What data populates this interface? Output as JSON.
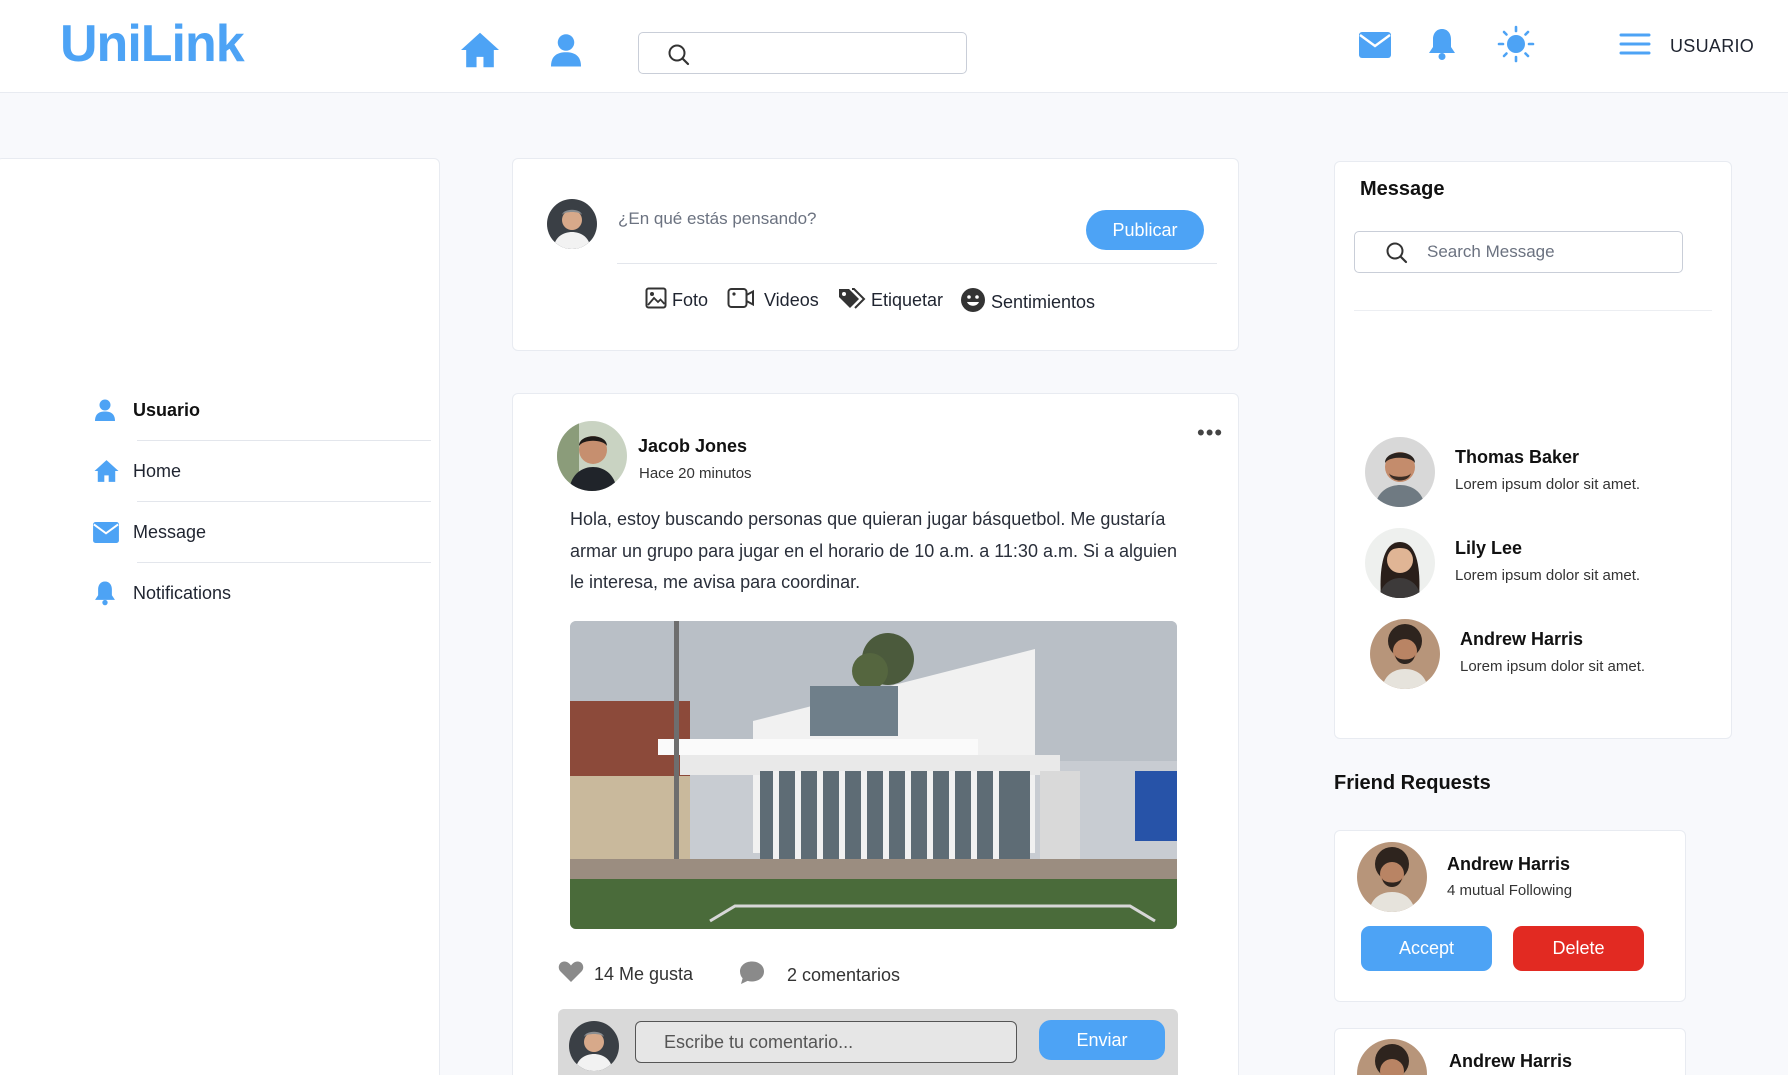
{
  "app": {
    "logo": "UniLink",
    "accent": "#4da3f5",
    "danger": "#e22a22"
  },
  "header": {
    "nav_icons": [
      "home-icon",
      "user-icon"
    ],
    "search_placeholder": "",
    "right_icons": [
      "mail-icon",
      "bell-icon",
      "theme-sun-icon",
      "menu-icon"
    ],
    "user_label": "USUARIO"
  },
  "sidebar": {
    "items": [
      {
        "label": "Usuario",
        "icon": "user-icon",
        "active": true
      },
      {
        "label": "Home",
        "icon": "home-icon",
        "active": false
      },
      {
        "label": "Message",
        "icon": "mail-icon",
        "active": false
      },
      {
        "label": "Notifications",
        "icon": "bell-icon",
        "active": false
      }
    ]
  },
  "composer": {
    "placeholder": "¿En qué estás pensando?",
    "publish_label": "Publicar",
    "attachments": [
      {
        "label": "Foto",
        "icon": "image-icon"
      },
      {
        "label": "Videos",
        "icon": "video-icon"
      },
      {
        "label": "Etiquetar",
        "icon": "tag-icon"
      },
      {
        "label": "Sentimientos",
        "icon": "smile-icon"
      }
    ]
  },
  "post": {
    "author": "Jacob Jones",
    "time": "Hace 20 minutos",
    "text": "Hola, estoy buscando personas que quieran jugar básquetbol. Me gustaría armar un grupo para jugar en el horario de 10 a.m. a 11:30 a.m. Si a alguien le interesa, me avisa para coordinar.",
    "likes": "14 Me gusta",
    "comments": "2 comentarios",
    "comment_placeholder": "Escribe tu comentario...",
    "send_label": "Enviar"
  },
  "messages": {
    "title": "Message",
    "search_placeholder": "Search Message",
    "contacts": [
      {
        "name": "Thomas Baker",
        "preview": "Lorem ipsum dolor sit amet."
      },
      {
        "name": "Lily Lee",
        "preview": "Lorem ipsum dolor sit amet."
      },
      {
        "name": "Andrew Harris",
        "preview": "Lorem ipsum dolor sit amet."
      }
    ]
  },
  "friend_requests": {
    "title": "Friend Requests",
    "items": [
      {
        "name": "Andrew Harris",
        "mutual": "4 mutual Following",
        "accept_label": "Accept",
        "delete_label": "Delete"
      },
      {
        "name": "Andrew Harris"
      }
    ]
  }
}
